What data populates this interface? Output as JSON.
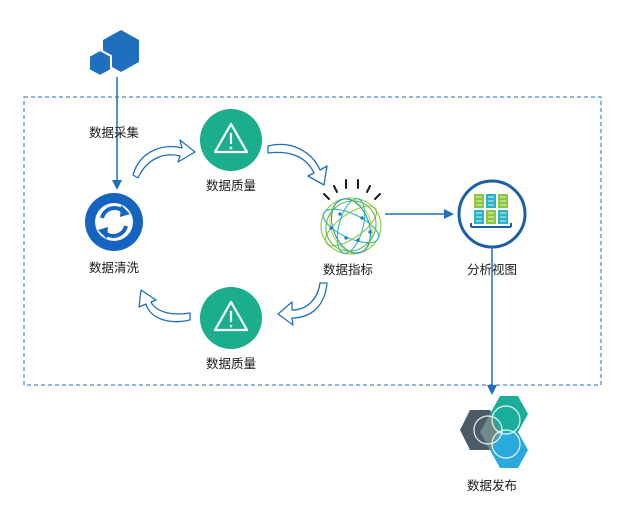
{
  "labels": {
    "collect": "数据采集",
    "clean": "数据清洗",
    "quality_top": "数据质量",
    "quality_bottom": "数据质量",
    "metrics": "数据指标",
    "view": "分析视图",
    "publish": "数据发布"
  },
  "colors": {
    "boundary": "#1f6fbd",
    "arrow": "#1f6fbd",
    "hexagon_blue": "#1e6fbe",
    "refresh_circle": "#1565c0",
    "warning_circle": "#1aae8c",
    "view_ring": "#1a5ea8",
    "view_bars_green": "#8dc63f",
    "view_bars_teal": "#2ab3c7",
    "hex_dark": "#4b5c68",
    "hex_teal": "#1aae9a",
    "hex_cyan": "#29a9dc"
  },
  "icons": {
    "collect": "blue-hexagons-icon",
    "clean": "refresh-icon",
    "quality": "warning-icon",
    "metrics": "data-sphere-icon",
    "view": "container-view-icon",
    "publish": "hexagon-cluster-icon"
  }
}
